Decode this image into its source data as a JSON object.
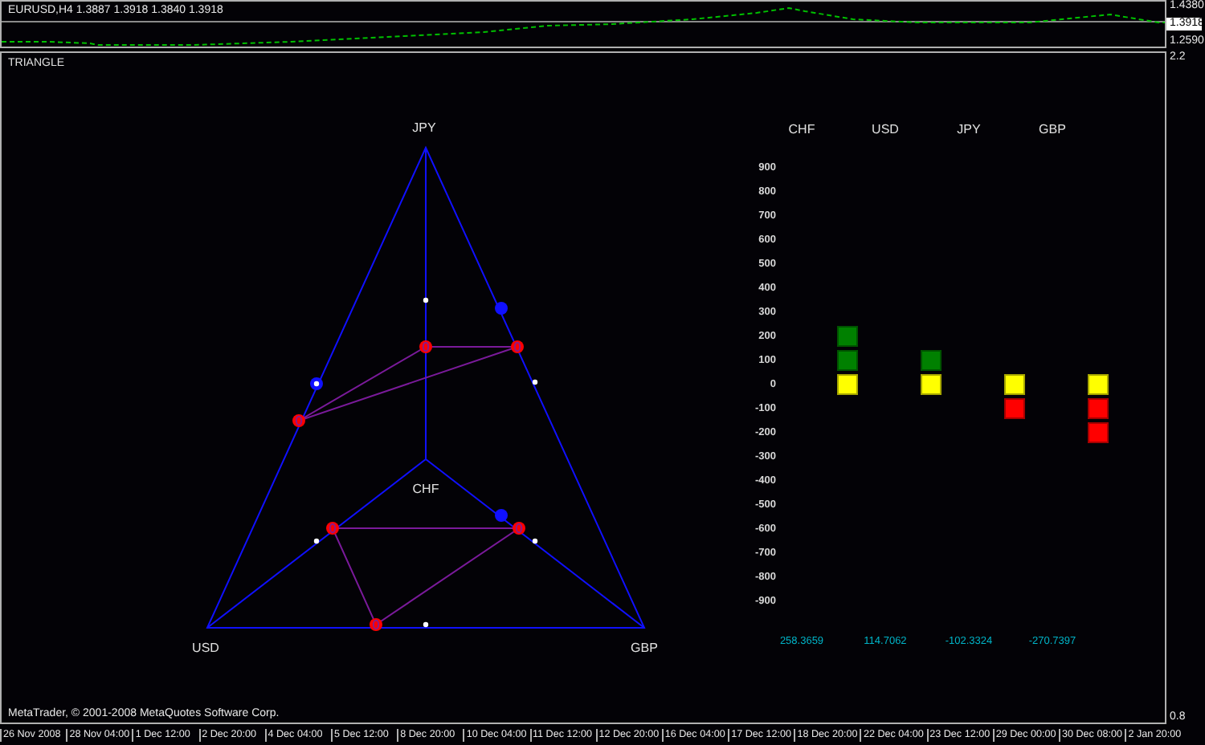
{
  "price_panel": {
    "symbol_info": "EURUSD,H4  1.3887 1.3918 1.3840 1.3918",
    "axis_labels": [
      "1.4380",
      "1.3918",
      "1.2590"
    ]
  },
  "indicator_panel": {
    "name": "TRIANGLE",
    "axis_labels": [
      "2.2",
      "0.8"
    ],
    "triangle": {
      "top_label": "JPY",
      "left_label": "USD",
      "right_label": "GBP",
      "center_label": "CHF"
    },
    "strength": {
      "scale": [
        "900",
        "800",
        "700",
        "600",
        "500",
        "400",
        "300",
        "200",
        "100",
        "0",
        "-100",
        "-200",
        "-300",
        "-400",
        "-500",
        "-600",
        "-700",
        "-800",
        "-900"
      ],
      "columns": [
        {
          "currency": "CHF",
          "reading": "258.3659",
          "blocks": [
            {
              "kind": "gain"
            },
            {
              "kind": "gain"
            },
            {
              "kind": "flat"
            }
          ]
        },
        {
          "currency": "USD",
          "reading": "114.7062",
          "blocks": [
            {
              "kind": "gain"
            },
            {
              "kind": "flat"
            }
          ]
        },
        {
          "currency": "JPY",
          "reading": "-102.3324",
          "blocks": [
            {
              "kind": "flat"
            },
            {
              "kind": "loss"
            }
          ]
        },
        {
          "currency": "GBP",
          "reading": "-270.7397",
          "blocks": [
            {
              "kind": "flat"
            },
            {
              "kind": "loss"
            },
            {
              "kind": "loss"
            }
          ]
        }
      ]
    },
    "footer": "MetaTrader, © 2001-2008 MetaQuotes Software Corp."
  },
  "time_axis": [
    "26 Nov 2008",
    "28 Nov 04:00",
    "1 Dec 12:00",
    "2 Dec 20:00",
    "4 Dec 04:00",
    "5 Dec 12:00",
    "8 Dec 20:00",
    "10 Dec 04:00",
    "11 Dec 12:00",
    "12 Dec 20:00",
    "16 Dec 04:00",
    "17 Dec 12:00",
    "18 Dec 20:00",
    "22 Dec 04:00",
    "23 Dec 12:00",
    "29 Dec 00:00",
    "30 Dec 08:00",
    "2 Jan 20:00"
  ]
}
